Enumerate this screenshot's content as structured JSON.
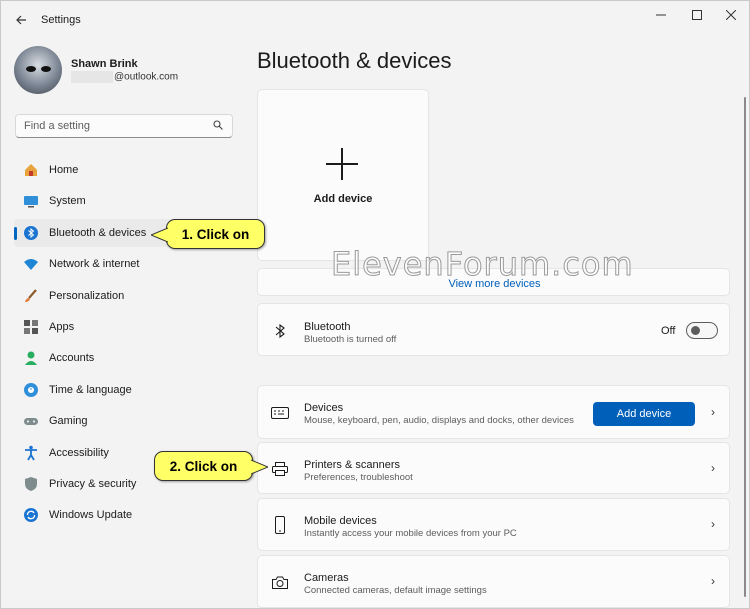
{
  "window": {
    "title": "Settings"
  },
  "user": {
    "name": "Shawn Brink",
    "email_suffix": "@outlook.com"
  },
  "search": {
    "placeholder": "Find a setting"
  },
  "sidebar": {
    "items": [
      {
        "label": "Home",
        "icon": "home-icon"
      },
      {
        "label": "System",
        "icon": "system-icon"
      },
      {
        "label": "Bluetooth & devices",
        "icon": "bluetooth-icon",
        "active": true
      },
      {
        "label": "Network & internet",
        "icon": "wifi-icon"
      },
      {
        "label": "Personalization",
        "icon": "brush-icon"
      },
      {
        "label": "Apps",
        "icon": "apps-icon"
      },
      {
        "label": "Accounts",
        "icon": "accounts-icon"
      },
      {
        "label": "Time & language",
        "icon": "globe-icon"
      },
      {
        "label": "Gaming",
        "icon": "gamepad-icon"
      },
      {
        "label": "Accessibility",
        "icon": "accessibility-icon"
      },
      {
        "label": "Privacy & security",
        "icon": "shield-icon"
      },
      {
        "label": "Windows Update",
        "icon": "update-icon"
      }
    ]
  },
  "main": {
    "title": "Bluetooth & devices",
    "add_device_tile": "Add device",
    "view_more": "View more devices",
    "bluetooth": {
      "title": "Bluetooth",
      "subtitle": "Bluetooth is turned off",
      "toggle_label": "Off",
      "enabled": false
    },
    "devices": {
      "title": "Devices",
      "subtitle": "Mouse, keyboard, pen, audio, displays and docks, other devices",
      "button": "Add device"
    },
    "printers": {
      "title": "Printers & scanners",
      "subtitle": "Preferences, troubleshoot"
    },
    "mobile": {
      "title": "Mobile devices",
      "subtitle": "Instantly access your mobile devices from your PC"
    },
    "cameras": {
      "title": "Cameras",
      "subtitle": "Connected cameras, default image settings"
    }
  },
  "annotations": {
    "step1": "1. Click on",
    "step2": "2. Click on"
  },
  "watermark": "ElevenForum.com",
  "colors": {
    "accent": "#005fb8",
    "callout": "#ffff66"
  }
}
